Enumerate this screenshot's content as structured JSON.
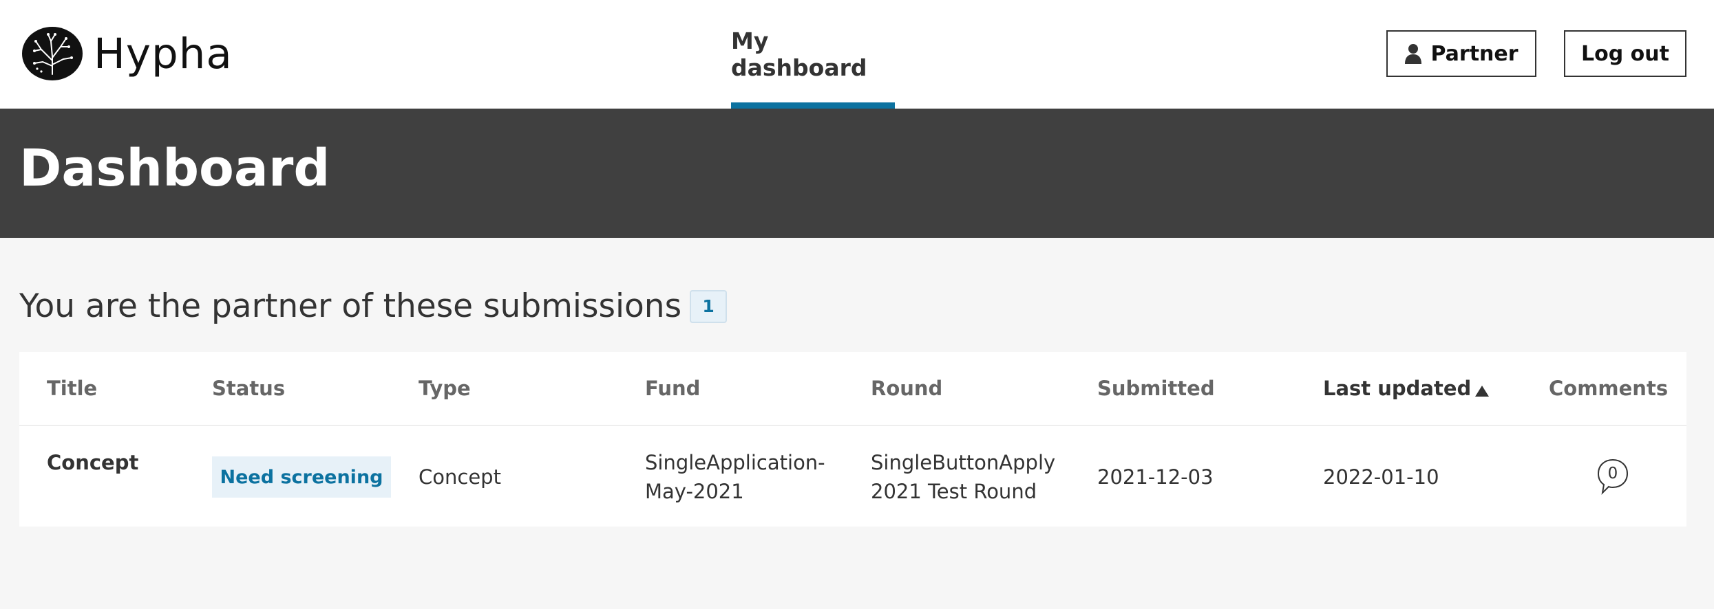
{
  "header": {
    "logo_text": "Hypha",
    "nav": {
      "dashboard_label": "My dashboard"
    },
    "partner_button": "Partner",
    "logout_button": "Log out"
  },
  "hero": {
    "title": "Dashboard"
  },
  "section": {
    "title": "You are the partner of these submissions",
    "count": "1"
  },
  "table": {
    "columns": [
      "Title",
      "Status",
      "Type",
      "Fund",
      "Round",
      "Submitted",
      "Last updated",
      "Comments"
    ],
    "sorted_column": "Last updated",
    "sort_direction": "ascending",
    "rows": [
      {
        "title": "Concept",
        "status": "Need screening",
        "type": "Concept",
        "fund_line1": "SingleApplication-",
        "fund_line2": "May-2021",
        "round_line1": "SingleButtonApply",
        "round_line2": "2021 Test Round",
        "submitted": "2021-12-03",
        "last_updated": "2022-01-10",
        "comments": "0"
      }
    ]
  },
  "colors": {
    "accent": "#0c72a0",
    "hero_bg": "#404040",
    "page_bg": "#f6f6f6",
    "badge_bg": "#e7f1f8"
  },
  "icons": {
    "logo": "tree-logo-icon",
    "partner": "user-icon",
    "sort": "sort-ascending-icon",
    "comments": "speech-bubble-icon"
  }
}
